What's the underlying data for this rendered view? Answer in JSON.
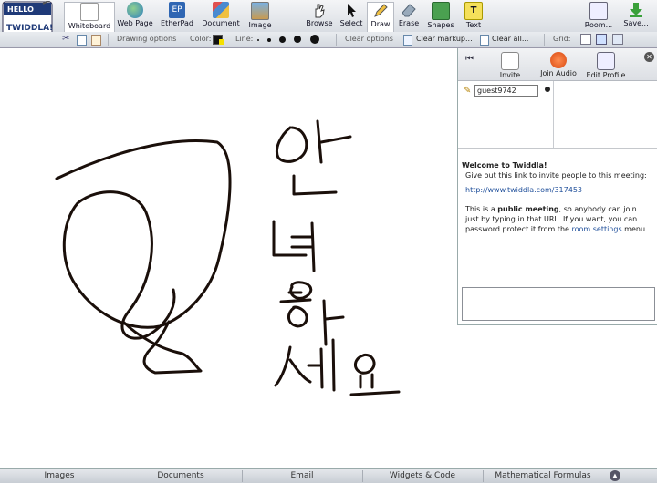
{
  "logo": {
    "line1": "HELLO",
    "line2": "TWIDDLA!"
  },
  "toolbar": {
    "whiteboard": "Whiteboard",
    "webpage": "Web Page",
    "etherpad": "EtherPad",
    "etherpad_icon": "EP",
    "document": "Document",
    "image": "Image",
    "browse": "Browse",
    "select": "Select",
    "draw": "Draw",
    "erase": "Erase",
    "shapes": "Shapes",
    "text": "Text",
    "text_icon": "T",
    "room": "Room...",
    "save": "Save..."
  },
  "subbar": {
    "drawing_options": "Drawing options",
    "color": "Color:",
    "line": "Line:",
    "clear_options": "Clear options",
    "clear_markup": "Clear markup...",
    "clear_all": "Clear all...",
    "grid": "Grid:"
  },
  "colors": {
    "stroke": "#1a0f0a",
    "accent": "#2a55a0"
  },
  "panel": {
    "invite": "Invite",
    "join_audio": "Join Audio",
    "edit_profile": "Edit Profile",
    "username": "guest9742",
    "welcome_title": "Welcome to Twiddla!",
    "welcome_line1": "Give out this link to invite people to this meeting:",
    "link": "http://www.twiddla.com/317453",
    "para_pre": "This is a ",
    "para_bold": "public meeting",
    "para_mid": ", so anybody can join just by typing in that URL. If you want, you can password protect it from the ",
    "para_link": "room settings",
    "para_post": " menu."
  },
  "bottom_tabs": [
    "Images",
    "Documents",
    "Email",
    "Widgets & Code",
    "Mathematical Formulas"
  ]
}
